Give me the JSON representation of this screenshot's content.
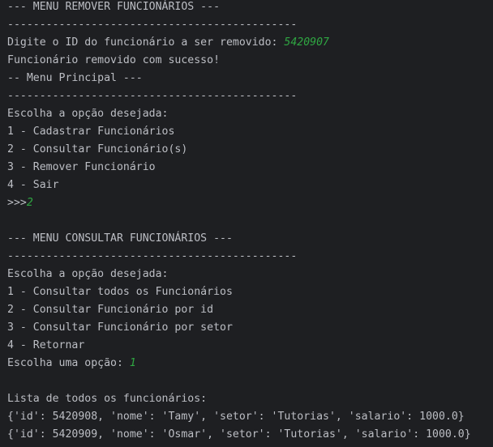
{
  "colors": {
    "background": "#1e1f22",
    "text": "#bcbec4",
    "user_input": "#2fa642"
  },
  "console": {
    "lines": [
      {
        "text": "--- MENU REMOVER FUNCIONÁRIOS ---",
        "input": ""
      },
      {
        "text": "---------------------------------------------",
        "input": ""
      },
      {
        "text": "Digite o ID do funcionário a ser removido: ",
        "input": "5420907"
      },
      {
        "text": "Funcionário removido com sucesso!",
        "input": ""
      },
      {
        "text": "-- Menu Principal ---",
        "input": ""
      },
      {
        "text": "---------------------------------------------",
        "input": ""
      },
      {
        "text": "Escolha a opção desejada:",
        "input": ""
      },
      {
        "text": "1 - Cadastrar Funcionários",
        "input": ""
      },
      {
        "text": "2 - Consultar Funcionário(s)",
        "input": ""
      },
      {
        "text": "3 - Remover Funcionário",
        "input": ""
      },
      {
        "text": "4 - Sair",
        "input": ""
      },
      {
        "text": ">>>",
        "input": "2"
      },
      {
        "text": "",
        "input": ""
      },
      {
        "text": "--- MENU CONSULTAR FUNCIONÁRIOS ---",
        "input": ""
      },
      {
        "text": "---------------------------------------------",
        "input": ""
      },
      {
        "text": "Escolha a opção desejada:",
        "input": ""
      },
      {
        "text": "1 - Consultar todos os Funcionários",
        "input": ""
      },
      {
        "text": "2 - Consultar Funcionário por id",
        "input": ""
      },
      {
        "text": "3 - Consultar Funcionário por setor",
        "input": ""
      },
      {
        "text": "4 - Retornar",
        "input": ""
      },
      {
        "text": "Escolha uma opção: ",
        "input": "1"
      },
      {
        "text": "",
        "input": ""
      },
      {
        "text": "Lista de todos os funcionários:",
        "input": ""
      },
      {
        "text": "{'id': 5420908, 'nome': 'Tamy', 'setor': 'Tutorias', 'salario': 1000.0}",
        "input": ""
      },
      {
        "text": "{'id': 5420909, 'nome': 'Osmar', 'setor': 'Tutorias', 'salario': 1000.0}",
        "input": ""
      }
    ]
  }
}
